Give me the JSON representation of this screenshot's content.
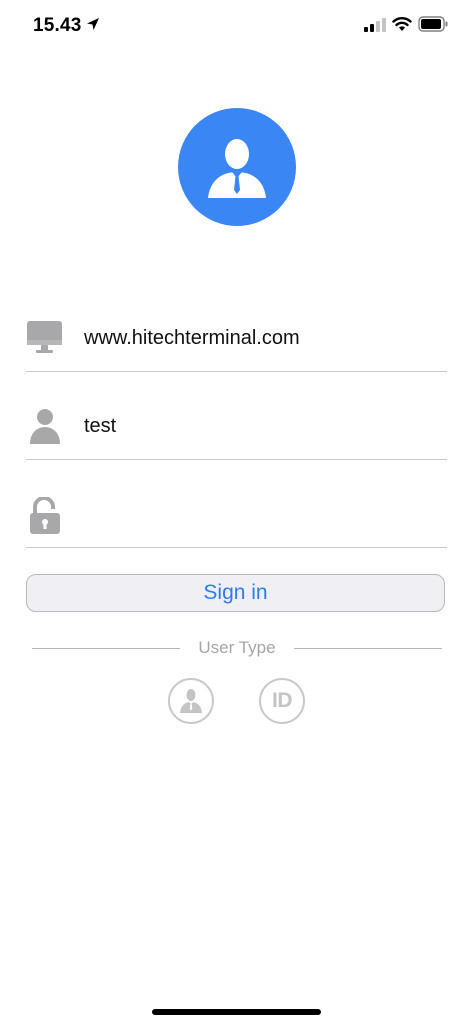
{
  "status_bar": {
    "time": "15.43",
    "icons": [
      "location-arrow-icon",
      "cellular-signal-icon",
      "wifi-icon",
      "battery-icon"
    ]
  },
  "avatar": {
    "icon": "businessman-avatar-icon",
    "color": "#3a86f5"
  },
  "form": {
    "server": {
      "icon": "monitor-icon",
      "value": "www.hitechterminal.com",
      "placeholder": ""
    },
    "username": {
      "icon": "person-icon",
      "value": "test",
      "placeholder": ""
    },
    "password": {
      "icon": "lock-icon",
      "value": "",
      "placeholder": ""
    },
    "signin_label": "Sign in"
  },
  "user_type": {
    "label": "User Type",
    "options": [
      {
        "icon": "person-user-icon"
      },
      {
        "icon": "id-icon",
        "label": "ID"
      }
    ]
  },
  "colors": {
    "accent": "#2d7cf6",
    "icon_gray": "#a8a8ab",
    "divider": "#c8c8cc"
  }
}
